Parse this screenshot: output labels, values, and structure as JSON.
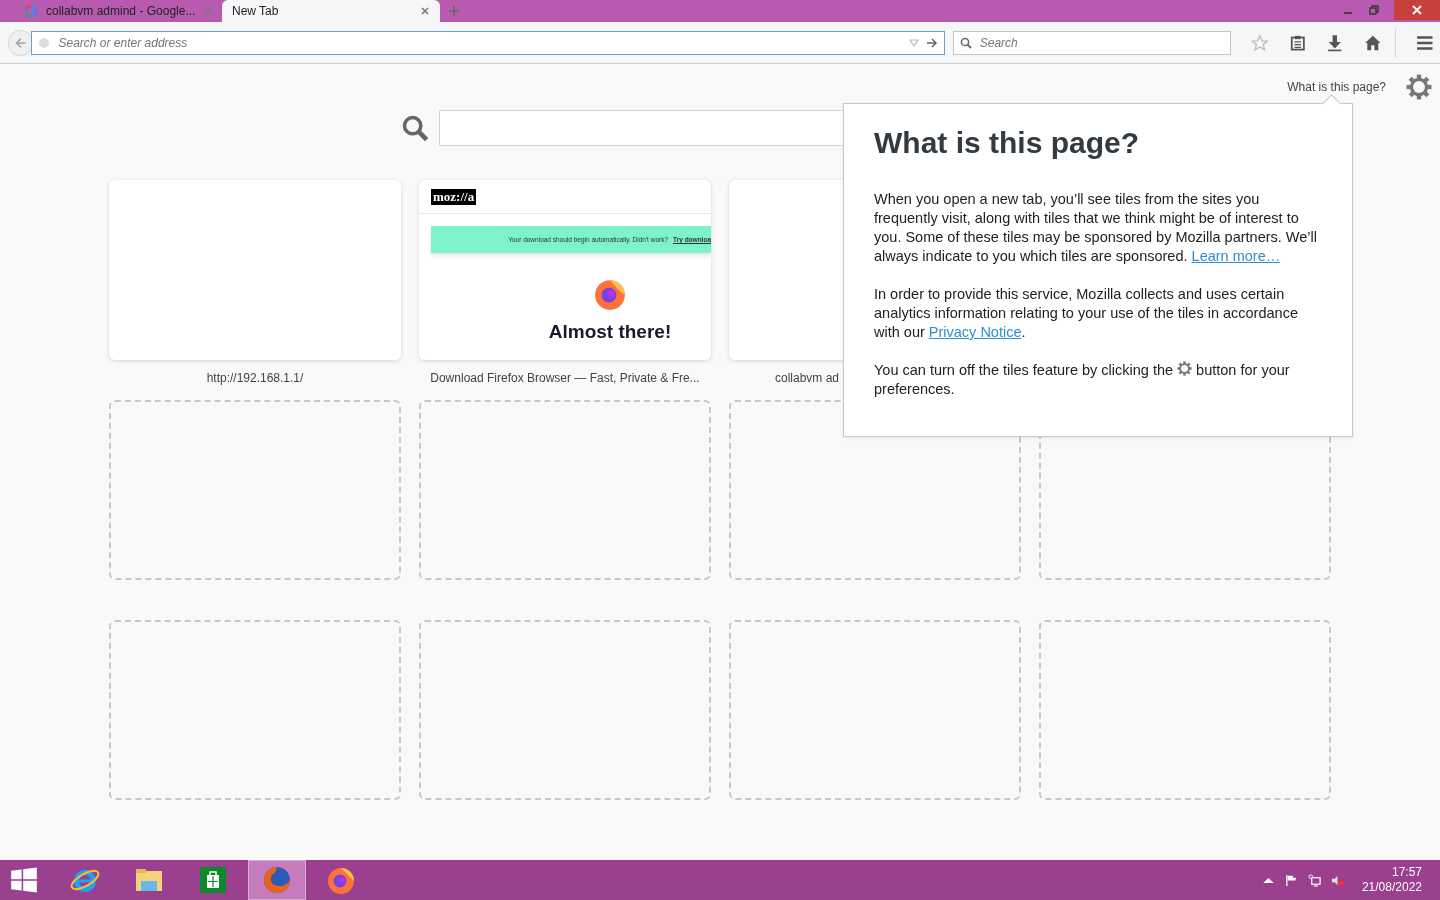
{
  "tabs": [
    {
      "title": "collabvm admind - Google...",
      "selected": false
    },
    {
      "title": "New Tab",
      "selected": true
    }
  ],
  "address_bar": {
    "placeholder": "Search or enter address"
  },
  "search_bar": {
    "placeholder": "Search"
  },
  "new_tab": {
    "help_link": "What is this page?",
    "rows": [
      [
        {
          "kind": "site",
          "title": "http://192.168.1.1/"
        },
        {
          "kind": "preview",
          "title": "Download Firefox Browser — Fast, Private & Fre...",
          "preview": {
            "logo": "moz://a",
            "notice": "Your download should begin automatically. Didn't work?",
            "notice_link": "Try downloa",
            "heading": "Almost there!"
          }
        },
        {
          "kind": "site",
          "title": "collabvm ad"
        }
      ],
      [
        {
          "kind": "empty"
        },
        {
          "kind": "empty"
        },
        {
          "kind": "empty"
        },
        {
          "kind": "empty"
        }
      ],
      [
        {
          "kind": "empty"
        },
        {
          "kind": "empty"
        },
        {
          "kind": "empty"
        },
        {
          "kind": "empty"
        }
      ]
    ]
  },
  "popup": {
    "title": "What is this page?",
    "paragraphs": [
      [
        {
          "kind": "text",
          "text": "When you open a new tab, you’ll see tiles from the sites you frequently visit, along with tiles that we think might be of interest to you. Some of these tiles may be sponsored by Mozilla partners. We’ll always indicate to you which tiles are sponsored. "
        },
        {
          "kind": "link",
          "text": "Learn more…"
        }
      ],
      [
        {
          "kind": "text",
          "text": "In order to provide this service, Mozilla collects and uses certain analytics information relating to your use of the tiles in accordance with our "
        },
        {
          "kind": "link",
          "text": "Privacy Notice"
        },
        {
          "kind": "text",
          "text": "."
        }
      ],
      [
        {
          "kind": "text",
          "text": "You can turn off the tiles feature by clicking the "
        },
        {
          "kind": "gear"
        },
        {
          "kind": "text",
          "text": " button for your preferences."
        }
      ]
    ]
  },
  "taskbar": {
    "apps": [
      {
        "kind": "ie",
        "selected": false
      },
      {
        "kind": "folder",
        "selected": false
      },
      {
        "kind": "store",
        "selected": false
      },
      {
        "kind": "firefox-old",
        "selected": true
      },
      {
        "kind": "firefox",
        "selected": false
      }
    ],
    "time": "17:57",
    "date": "21/08/2022"
  }
}
